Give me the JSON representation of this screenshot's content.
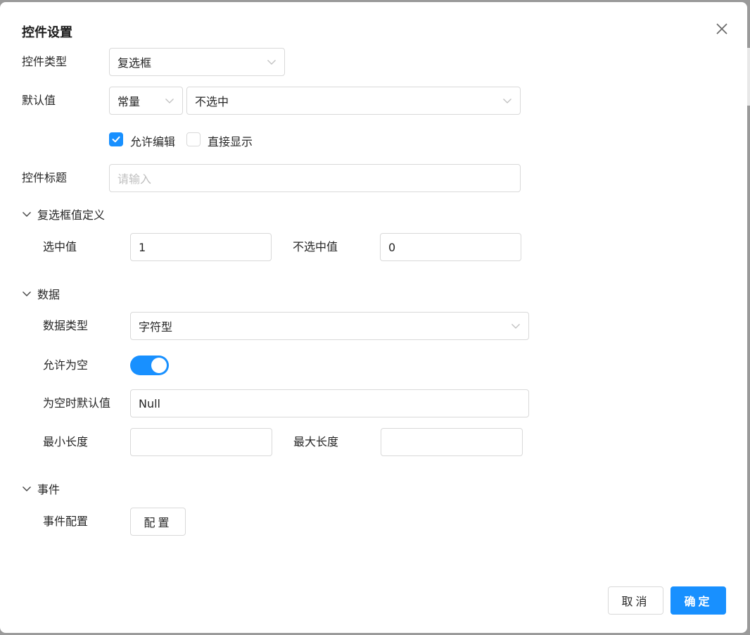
{
  "dialog": {
    "title": "控件设置",
    "close_icon": "close-icon"
  },
  "control_type": {
    "label": "控件类型",
    "value": "复选框"
  },
  "default_value": {
    "label": "默认值",
    "mode": "常量",
    "value": "不选中"
  },
  "options": {
    "allow_edit": {
      "label": "允许编辑",
      "checked": true
    },
    "direct_display": {
      "label": "直接显示",
      "checked": false
    }
  },
  "control_title": {
    "label": "控件标题",
    "placeholder": "请输入",
    "value": ""
  },
  "checkbox_values": {
    "section_label": "复选框值定义",
    "checked_label": "选中值",
    "checked_value": "1",
    "unchecked_label": "不选中值",
    "unchecked_value": "0"
  },
  "data": {
    "section_label": "数据",
    "type_label": "数据类型",
    "type_value": "字符型",
    "allow_empty_label": "允许为空",
    "allow_empty_on": true,
    "empty_default_label": "为空时默认值",
    "empty_default_value": "Null",
    "min_length_label": "最小长度",
    "min_length_value": "",
    "max_length_label": "最大长度",
    "max_length_value": ""
  },
  "events": {
    "section_label": "事件",
    "config_label": "事件配置",
    "config_button": "配置"
  },
  "footer": {
    "cancel": "取消",
    "confirm": "确定"
  },
  "colors": {
    "primary": "#1890ff",
    "border": "#d9d9d9",
    "placeholder": "#bfbfbf"
  }
}
